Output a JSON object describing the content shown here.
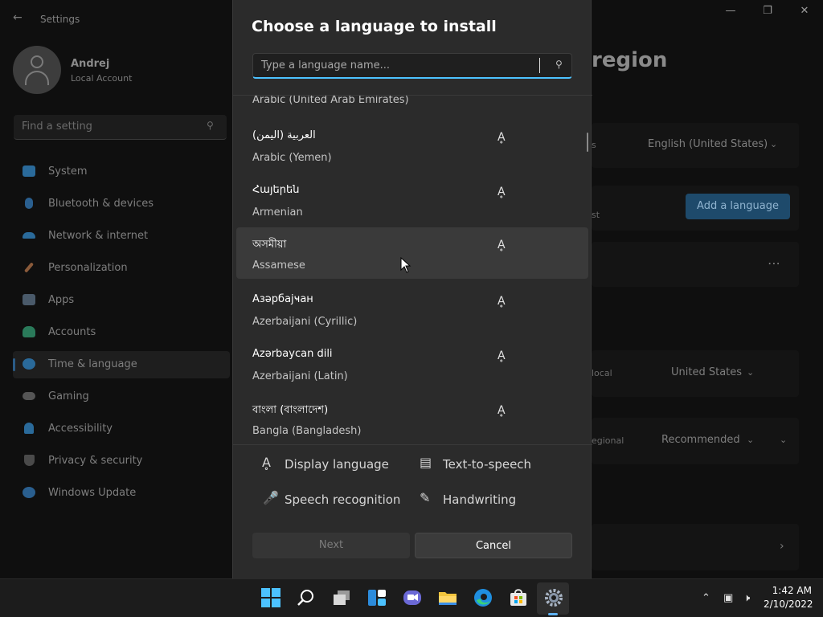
{
  "settings": {
    "app_title": "Settings",
    "user": {
      "name": "Andrej",
      "account_type": "Local Account"
    },
    "search_placeholder": "Find a setting",
    "nav": [
      {
        "label": "System",
        "icon": "monitor-icon",
        "color": "#2a6a9a"
      },
      {
        "label": "Bluetooth & devices",
        "icon": "bluetooth-icon",
        "color": "#2a5f8f"
      },
      {
        "label": "Network & internet",
        "icon": "wifi-icon",
        "color": "#2a6a9a"
      },
      {
        "label": "Personalization",
        "icon": "brush-icon",
        "color": "#8a5a3a"
      },
      {
        "label": "Apps",
        "icon": "apps-icon",
        "color": "#4a5a6a"
      },
      {
        "label": "Accounts",
        "icon": "person-icon",
        "color": "#2a7a5a"
      },
      {
        "label": "Time & language",
        "icon": "globe-clock-icon",
        "color": "#2a6a9a",
        "selected": true
      },
      {
        "label": "Gaming",
        "icon": "gamepad-icon",
        "color": "#555555"
      },
      {
        "label": "Accessibility",
        "icon": "accessibility-icon",
        "color": "#2a6a9a"
      },
      {
        "label": "Privacy & security",
        "icon": "shield-icon",
        "color": "#4a4a4a"
      },
      {
        "label": "Windows Update",
        "icon": "update-icon",
        "color": "#2a5f8f"
      }
    ],
    "main": {
      "title_fragment": "region",
      "display_language_value": "English (United States)",
      "add_language_label": "Add a language",
      "country_value": "United States",
      "regional_format_value": "Recommended",
      "partial_labels": {
        "s": "s",
        "st": "st",
        "local": "local",
        "regional": "egional"
      }
    }
  },
  "dialog": {
    "title": "Choose a language to install",
    "search_placeholder": "Type a language name...",
    "partial_item": "Arabic (United Arab Emirates)",
    "languages": [
      {
        "native": "العربية (اليمن)",
        "english": "Arabic (Yemen)"
      },
      {
        "native": "Հայերեն",
        "english": "Armenian"
      },
      {
        "native": "অসমীয়া",
        "english": "Assamese",
        "hover": true
      },
      {
        "native": "Азәрбајҹан",
        "english": "Azerbaijani (Cyrillic)"
      },
      {
        "native": "Azərbaycan dili",
        "english": "Azerbaijani (Latin)"
      },
      {
        "native": "বাংলা (বাংলাদেশ)",
        "english": "Bangla (Bangladesh)"
      }
    ],
    "feature_icon": "display-language-icon",
    "features": [
      {
        "label": "Display language",
        "icon": "display-language-icon"
      },
      {
        "label": "Text-to-speech",
        "icon": "text-to-speech-icon"
      },
      {
        "label": "Speech recognition",
        "icon": "microphone-icon"
      },
      {
        "label": "Handwriting",
        "icon": "handwriting-icon"
      }
    ],
    "next_label": "Next",
    "cancel_label": "Cancel"
  },
  "taskbar": {
    "apps": [
      "start-icon",
      "search-icon",
      "task-view-icon",
      "widgets-icon",
      "chat-icon",
      "file-explorer-icon",
      "edge-icon",
      "store-icon",
      "settings-icon"
    ],
    "time": "1:42 AM",
    "date": "2/10/2022",
    "accent": "#5fb2f2"
  }
}
